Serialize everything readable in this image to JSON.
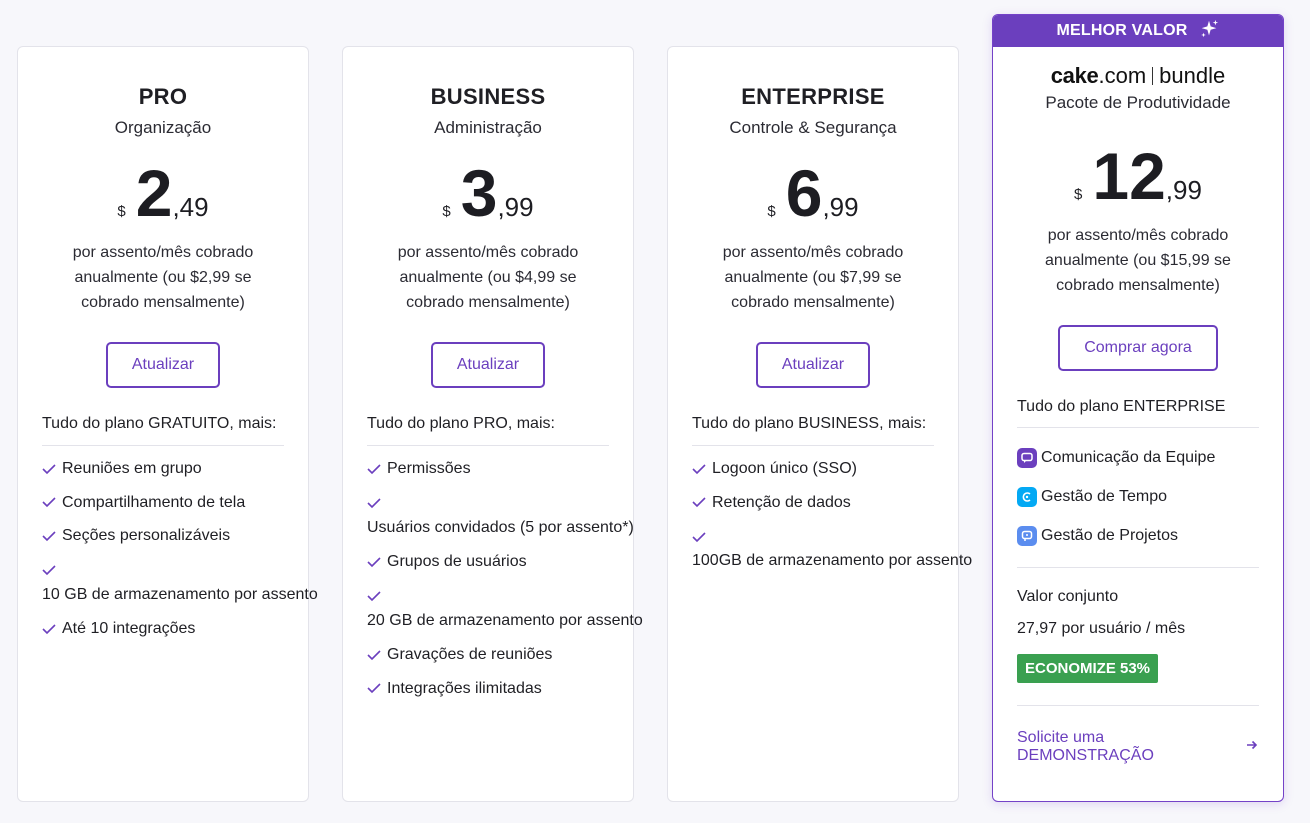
{
  "plans": [
    {
      "name": "PRO",
      "subtitle": "Organização",
      "currency": "$",
      "price_int": "2",
      "price_cents": ",49",
      "billing": "por assento/mês cobrado anualmente (ou $2,99 se cobrado mensalmente)",
      "button": "Atualizar",
      "includes": "Tudo do plano GRATUITO, mais:",
      "features": [
        "Reuniões em grupo",
        "Compartilhamento de tela",
        "Seções personalizáveis",
        "10 GB de armazenamento por assento",
        "Até 10 integrações"
      ]
    },
    {
      "name": "BUSINESS",
      "subtitle": "Administração",
      "currency": "$",
      "price_int": "3",
      "price_cents": ",99",
      "billing": "por assento/mês cobrado anualmente (ou $4,99 se cobrado mensalmente)",
      "button": "Atualizar",
      "includes": "Tudo do plano PRO, mais:",
      "features": [
        "Permissões",
        "Usuários convidados (5 por assento*)",
        "Grupos de usuários",
        "20 GB de armazenamento por assento",
        "Gravações de reuniões",
        "Integrações ilimitadas"
      ]
    },
    {
      "name": "ENTERPRISE",
      "subtitle": "Controle & Segurança",
      "currency": "$",
      "price_int": "6",
      "price_cents": ",99",
      "billing": "por assento/mês cobrado anualmente (ou $7,99 se cobrado mensalmente)",
      "button": "Atualizar",
      "includes": "Tudo do plano BUSINESS, mais:",
      "features": [
        "Logoon único (SSO)",
        "Retenção de dados",
        "100GB de armazenamento por assento"
      ]
    }
  ],
  "bundle": {
    "badge": "MELHOR VALOR",
    "logo_cake": "cake",
    "logo_com": ".com",
    "logo_bundle": "bundle",
    "subtitle": "Pacote de Produtividade",
    "currency": "$",
    "price_int": "12",
    "price_cents": ",99",
    "billing": "por assento/mês cobrado anualmente (ou $15,99 se cobrado mensalmente)",
    "button": "Comprar agora",
    "includes": "Tudo do plano ENTERPRISE",
    "apps": [
      {
        "label": "Comunicação da Equipe",
        "color": "#6b3fbe",
        "icon": "chat-icon"
      },
      {
        "label": "Gestão de Tempo",
        "color": "#03a9f4",
        "icon": "clock-icon"
      },
      {
        "label": "Gestão de Projetos",
        "color": "#5b8def",
        "icon": "project-icon"
      }
    ],
    "combined_label": "Valor conjunto",
    "combined_value": "27,97 por usuário / mês",
    "save": "ECONOMIZE 53%",
    "demo": "Solicite uma DEMONSTRAÇÃO"
  },
  "colors": {
    "accent": "#6b3fbe",
    "save_green": "#3aa050",
    "background": "#f7f7fb"
  }
}
